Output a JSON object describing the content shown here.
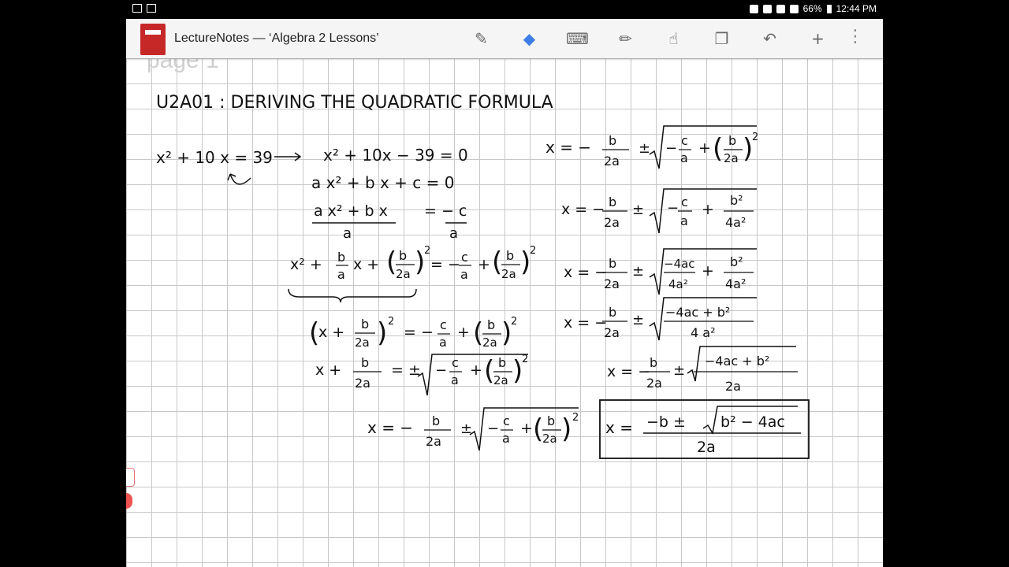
{
  "statusbar": {
    "battery": "66%",
    "time": "12:44 PM"
  },
  "app": {
    "title": "LectureNotes — ‘Algebra 2 Lessons’"
  },
  "toolbar": {
    "tools": [
      {
        "name": "pen-settings-icon",
        "glyph": "✎"
      },
      {
        "name": "eraser-icon",
        "glyph": "◆"
      },
      {
        "name": "keyboard-icon",
        "glyph": "⌨"
      },
      {
        "name": "pencil-icon",
        "glyph": "✏"
      },
      {
        "name": "hand-icon",
        "glyph": "☝"
      },
      {
        "name": "copy-layers-icon",
        "glyph": "❐"
      },
      {
        "name": "undo-icon",
        "glyph": "↶"
      },
      {
        "name": "add-icon",
        "glyph": "+"
      }
    ],
    "menu": "⋮"
  },
  "page": {
    "label": "page 1",
    "heading": "U2A01 : DERIVING THE QUADRATIC FORMULA"
  }
}
